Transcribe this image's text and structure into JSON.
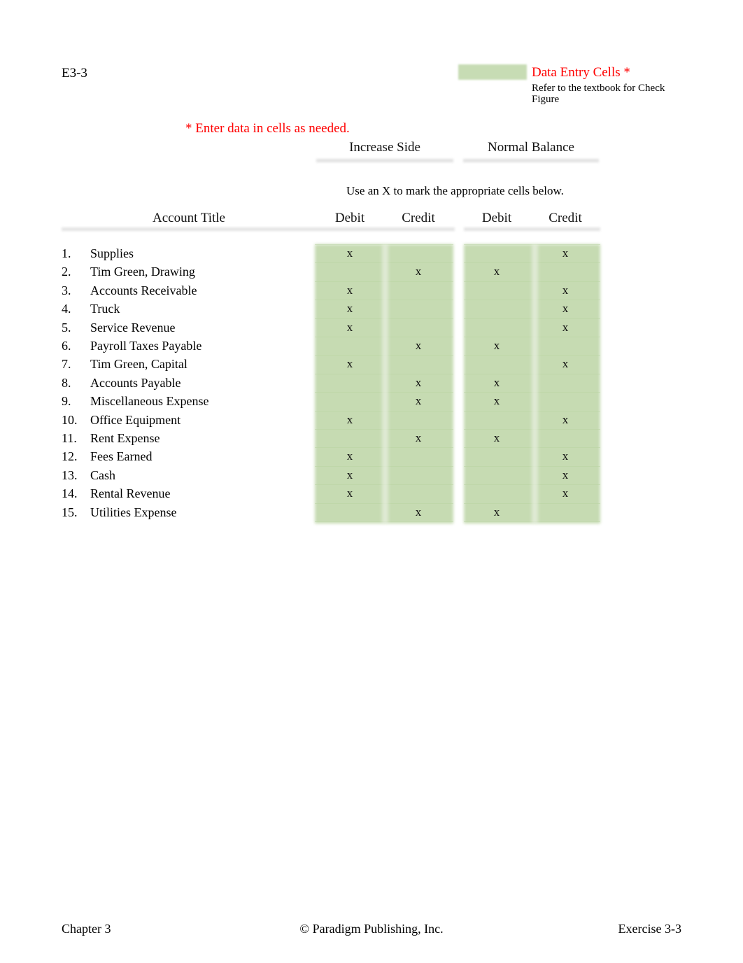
{
  "document": {
    "exercise_id": "E3-3"
  },
  "legend": {
    "swatch_color": "#c7dcb4",
    "title": "Data Entry Cells *",
    "note": "Refer to the textbook for Check Figure",
    "accent_color": "#ff0000"
  },
  "instructions": {
    "enter_data": "* Enter data in cells as needed.",
    "use_x": "Use an X to mark the appropriate cells below."
  },
  "table": {
    "group_headers": [
      {
        "label": "Increase Side"
      },
      {
        "label": "Normal Balance"
      }
    ],
    "column_headers": {
      "account_title": "Account Title",
      "increase_debit": "Debit",
      "increase_credit": "Credit",
      "normal_debit": "Debit",
      "normal_credit": "Credit"
    },
    "mark_symbol": "x",
    "rows": [
      {
        "num": "1.",
        "title": "Supplies",
        "increase_debit": "x",
        "increase_credit": "",
        "normal_debit": "",
        "normal_credit": "x"
      },
      {
        "num": "2.",
        "title": "Tim Green, Drawing",
        "increase_debit": "",
        "increase_credit": "x",
        "normal_debit": "x",
        "normal_credit": ""
      },
      {
        "num": "3.",
        "title": "Accounts Receivable",
        "increase_debit": "x",
        "increase_credit": "",
        "normal_debit": "",
        "normal_credit": "x"
      },
      {
        "num": "4.",
        "title": "Truck",
        "increase_debit": "x",
        "increase_credit": "",
        "normal_debit": "",
        "normal_credit": "x"
      },
      {
        "num": "5.",
        "title": "Service Revenue",
        "increase_debit": "x",
        "increase_credit": "",
        "normal_debit": "",
        "normal_credit": "x"
      },
      {
        "num": "6.",
        "title": "Payroll Taxes Payable",
        "increase_debit": "",
        "increase_credit": "x",
        "normal_debit": "x",
        "normal_credit": ""
      },
      {
        "num": "7.",
        "title": "Tim Green, Capital",
        "increase_debit": "x",
        "increase_credit": "",
        "normal_debit": "",
        "normal_credit": "x"
      },
      {
        "num": "8.",
        "title": "Accounts Payable",
        "increase_debit": "",
        "increase_credit": "x",
        "normal_debit": "x",
        "normal_credit": ""
      },
      {
        "num": "9.",
        "title": "Miscellaneous Expense",
        "increase_debit": "",
        "increase_credit": "x",
        "normal_debit": "x",
        "normal_credit": ""
      },
      {
        "num": "10.",
        "title": "Office Equipment",
        "increase_debit": "x",
        "increase_credit": "",
        "normal_debit": "",
        "normal_credit": "x"
      },
      {
        "num": "11.",
        "title": "Rent Expense",
        "increase_debit": "",
        "increase_credit": "x",
        "normal_debit": "x",
        "normal_credit": ""
      },
      {
        "num": "12.",
        "title": "Fees Earned",
        "increase_debit": "x",
        "increase_credit": "",
        "normal_debit": "",
        "normal_credit": "x"
      },
      {
        "num": "13.",
        "title": "Cash",
        "increase_debit": "x",
        "increase_credit": "",
        "normal_debit": "",
        "normal_credit": "x"
      },
      {
        "num": "14.",
        "title": "Rental Revenue",
        "increase_debit": "x",
        "increase_credit": "",
        "normal_debit": "",
        "normal_credit": "x"
      },
      {
        "num": "15.",
        "title": "Utilities Expense",
        "increase_debit": "",
        "increase_credit": "x",
        "normal_debit": "x",
        "normal_credit": ""
      }
    ]
  },
  "footer": {
    "left": "Chapter 3",
    "center": "© Paradigm Publishing, Inc.",
    "right": "Exercise 3-3"
  }
}
